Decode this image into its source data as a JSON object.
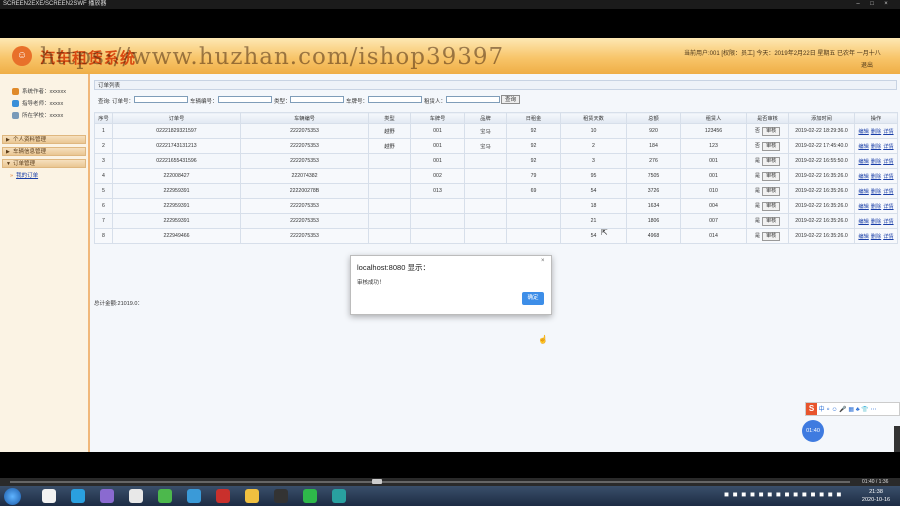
{
  "window": {
    "title": "SCREEN2EXE/SCREEN2SWF 播放器",
    "buttons": [
      "–",
      "□",
      "×"
    ]
  },
  "header": {
    "system_name": "汽车租赁系统",
    "watermark": "https://www.huzhan.com/ishop39397",
    "user_info": "当前用户:001 [权限：员工] 今天：2019年2月22日 星期五 已农年 一月十八",
    "logout": "退出"
  },
  "sidebar": {
    "user_lines": [
      {
        "label": "系统作者：xxxxxx",
        "icon_color": "#e08a2a"
      },
      {
        "label": "指导老师：xxxxx",
        "icon_color": "#3a8fd8"
      },
      {
        "label": "所在学校：xxxxx",
        "icon_color": "#7a9ab8"
      }
    ],
    "menus": [
      {
        "label": "个人资料管理",
        "arrow": "▶"
      },
      {
        "label": "车辆信息管理",
        "arrow": "▶"
      },
      {
        "label": "订单管理",
        "arrow": "▼"
      }
    ],
    "submenu": {
      "label": "我的订单",
      "bullet": "»"
    }
  },
  "panel": {
    "title": "订单列表"
  },
  "search": {
    "labels": {
      "prefix": "查询: 订单号：",
      "car_no": "车辆编号：",
      "type": "类型：",
      "card_no": "车牌号：",
      "renter": "租赁人："
    },
    "button": "查询"
  },
  "table": {
    "headers": [
      "序号",
      "订单号",
      "车辆编号",
      "类型",
      "车牌号",
      "品牌",
      "日租金",
      "租赁天数",
      "总额",
      "租赁人",
      "是否审核",
      "添加时间",
      "操作"
    ],
    "rows": [
      {
        "c": [
          "1",
          "02221829321597",
          "2222075353",
          "越野",
          "001",
          "宝马",
          "92",
          "10",
          "920",
          "123456",
          "否",
          "2019-02-22 18:29:36.0"
        ]
      },
      {
        "c": [
          "2",
          "02221743131213",
          "2222075353",
          "越野",
          "001",
          "宝马",
          "92",
          "2",
          "184",
          "123",
          "否",
          "2019-02-22 17:45:40.0"
        ]
      },
      {
        "c": [
          "3",
          "02221655431596",
          "2222075353",
          "",
          "001",
          "",
          "92",
          "3",
          "276",
          "001",
          "是",
          "2019-02-22 16:55:50.0"
        ]
      },
      {
        "c": [
          "4",
          "222008427",
          "222074382",
          "",
          "002",
          "",
          "79",
          "95",
          "7505",
          "001",
          "是",
          "2019-02-22 16:35:26.0"
        ]
      },
      {
        "c": [
          "5",
          "222959391",
          "222200278B",
          "",
          "013",
          "",
          "69",
          "54",
          "3726",
          "010",
          "是",
          "2019-02-22 16:35:26.0"
        ]
      },
      {
        "c": [
          "6",
          "222959391",
          "2222075353",
          "",
          "",
          "",
          "",
          "18",
          "1634",
          "004",
          "是",
          "2019-02-22 16:35:26.0"
        ]
      },
      {
        "c": [
          "7",
          "222959391",
          "2222075353",
          "",
          "",
          "",
          "",
          "21",
          "1806",
          "007",
          "是",
          "2019-02-22 16:35:26.0"
        ]
      },
      {
        "c": [
          "8",
          "222949466",
          "2222075353",
          "",
          "",
          "",
          "",
          "54",
          "4968",
          "014",
          "是",
          "2019-02-22 16:35:26.0"
        ]
      }
    ],
    "audit_button": "审核",
    "ops": [
      "编辑",
      "删除",
      "详情"
    ]
  },
  "total": "总计金额:21019.0：",
  "dialog": {
    "title": "localhost:8080 显示：",
    "message": "审核成功！",
    "ok": "确定",
    "close": "×"
  },
  "ime": {
    "logo": "S",
    "items": "中 ⸰ ☺ 🎤 ▦ ♣ 👕 ⋯"
  },
  "time_bubble": "01:40",
  "player": {
    "time": "01:40 / 1:36"
  },
  "taskbar": {
    "icon_colors": [
      "#f2f2f2",
      "#2aa0e0",
      "#8a6ad0",
      "#e8e8e8",
      "#4cb84c",
      "#3a9ad8",
      "#c9302c",
      "#f0c040",
      "#333333",
      "#2eb84a",
      "#29a0a0"
    ],
    "tray": "◼ ◼ ◼ ◼ ◼ ◼ ◼ ◼ ◼ ◼ ◼ ◼ ◼ ◼",
    "clock_time": "21:38",
    "clock_date": "2020-10-16"
  }
}
